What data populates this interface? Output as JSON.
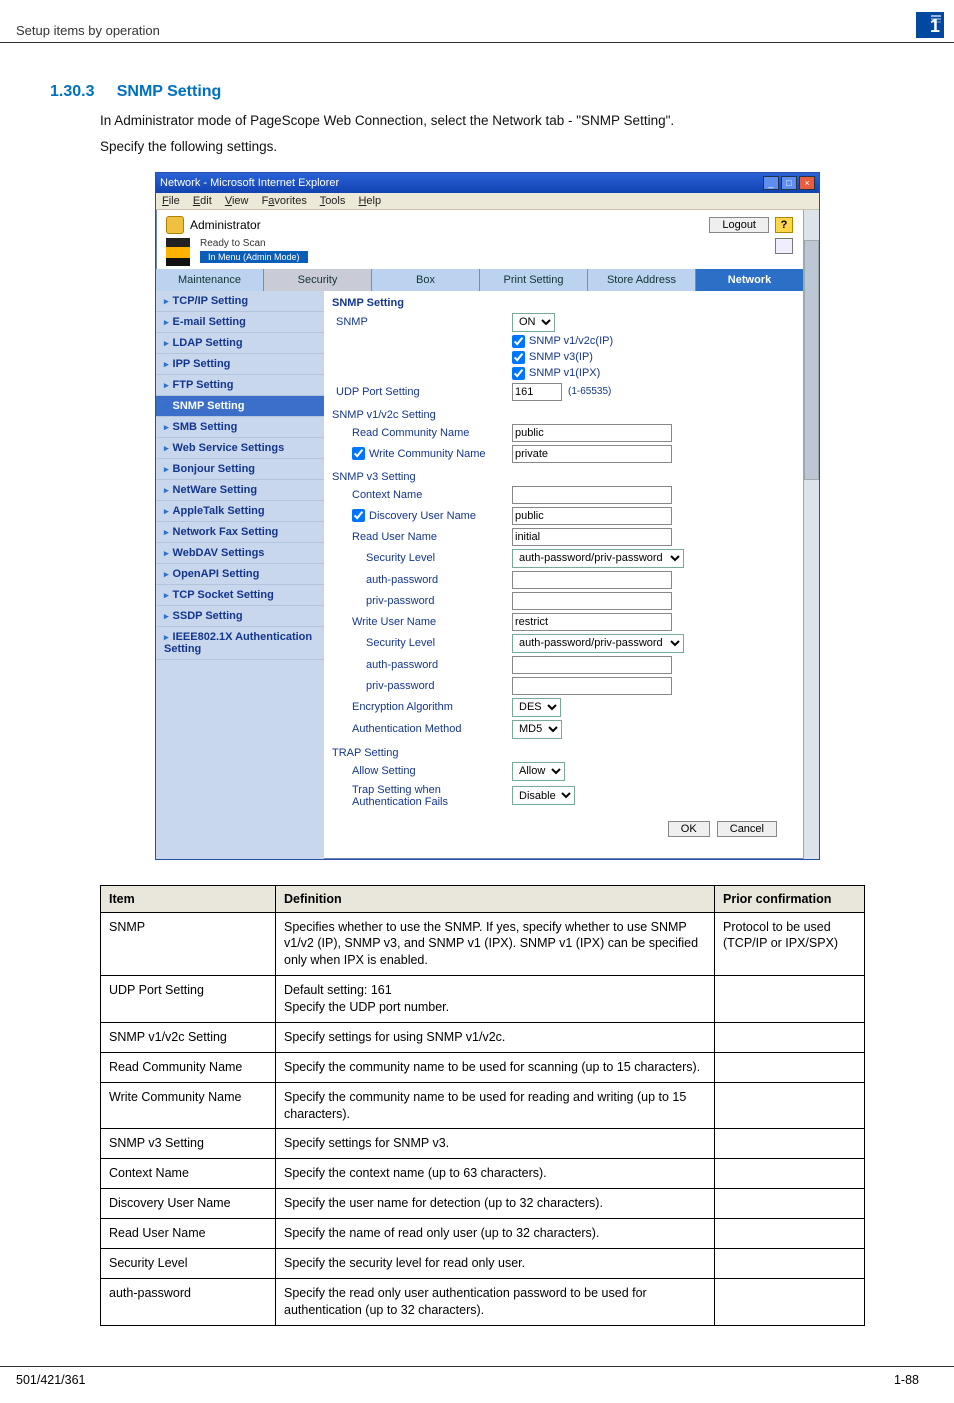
{
  "page": {
    "header_left": "Setup items by operation",
    "badge": "1",
    "section_number": "1.30.3",
    "section_title": "SNMP Setting",
    "para1": "In Administrator mode of PageScope Web Connection, select the Network tab - \"SNMP Setting\".",
    "para2": "Specify the following settings.",
    "footer_left": "501/421/361",
    "footer_right": "1-88"
  },
  "browser": {
    "title": "Network - Microsoft Internet Explorer",
    "menus": [
      "File",
      "Edit",
      "View",
      "Favorites",
      "Tools",
      "Help"
    ],
    "admin_label": "Administrator",
    "logout": "Logout",
    "ready": "Ready to Scan",
    "mode": "In Menu (Admin Mode)",
    "tabs": {
      "maintenance": "Maintenance",
      "security": "Security",
      "box": "Box",
      "print": "Print Setting",
      "store": "Store Address",
      "network": "Network"
    },
    "sidenav": [
      "TCP/IP Setting",
      "E-mail Setting",
      "LDAP Setting",
      "IPP Setting",
      "FTP Setting",
      "SNMP Setting",
      "SMB Setting",
      "Web Service Settings",
      "Bonjour Setting",
      "NetWare Setting",
      "AppleTalk Setting",
      "Network Fax Setting",
      "WebDAV Settings",
      "OpenAPI Setting",
      "TCP Socket Setting",
      "SSDP Setting",
      "IEEE802.1X Authentication Setting"
    ],
    "panel": {
      "title": "SNMP Setting",
      "snmp_label": "SNMP",
      "snmp_on": "ON",
      "chk_v1v2c": "SNMP v1/v2c(IP)",
      "chk_v3": "SNMP v3(IP)",
      "chk_v1ipx": "SNMP v1(IPX)",
      "udp_label": "UDP Port Setting",
      "udp_value": "161",
      "udp_range": "(1-65535)",
      "grp_v1v2c": "SNMP v1/v2c Setting",
      "read_comm": "Read Community Name",
      "read_comm_v": "public",
      "write_comm": "Write Community Name",
      "write_comm_v": "private",
      "grp_v3": "SNMP v3 Setting",
      "context": "Context Name",
      "disc_user": "Discovery User Name",
      "disc_user_v": "public",
      "read_user": "Read User Name",
      "read_user_v": "initial",
      "sec_level1": "Security Level",
      "sec_level1_v": "auth-password/priv-password",
      "auth_pw": "auth-password",
      "priv_pw": "priv-password",
      "write_user": "Write User Name",
      "write_user_v": "restrict",
      "sec_level2": "Security Level",
      "sec_level2_v": "auth-password/priv-password",
      "enc_alg": "Encryption Algorithm",
      "enc_alg_v": "DES",
      "auth_method": "Authentication Method",
      "auth_method_v": "MD5",
      "grp_trap": "TRAP Setting",
      "allow": "Allow Setting",
      "allow_v": "Allow",
      "trap_fail": "Trap Setting when Authentication Fails",
      "trap_fail_v": "Disable",
      "ok": "OK",
      "cancel": "Cancel"
    }
  },
  "definitions": {
    "headers": {
      "item": "Item",
      "def": "Definition",
      "prior": "Prior confirmation"
    },
    "rows": [
      {
        "item": "SNMP",
        "def": "Specifies whether to use the SNMP. If yes, specify whether to use SNMP v1/v2 (IP), SNMP v3, and SNMP v1 (IPX). SNMP v1 (IPX) can be specified only when IPX is enabled.",
        "prior": "Protocol to be used (TCP/IP or IPX/SPX)"
      },
      {
        "item": "UDP Port Setting",
        "def": "Default setting: 161\nSpecify the UDP port number.",
        "prior": ""
      },
      {
        "item": "SNMP v1/v2c Setting",
        "def": "Specify settings for using SNMP v1/v2c.",
        "prior": ""
      },
      {
        "item": "Read Community Name",
        "def": "Specify the community name to be used for scanning (up to 15 characters).",
        "prior": ""
      },
      {
        "item": "Write Community Name",
        "def": "Specify the community name to be used for reading and writing (up to 15 characters).",
        "prior": ""
      },
      {
        "item": "SNMP v3 Setting",
        "def": "Specify settings for SNMP v3.",
        "prior": ""
      },
      {
        "item": "Context Name",
        "def": "Specify the context name (up to 63 characters).",
        "prior": ""
      },
      {
        "item": "Discovery User Name",
        "def": "Specify the user name for detection (up to 32 characters).",
        "prior": ""
      },
      {
        "item": "Read User Name",
        "def": "Specify the name of read only user (up to 32 characters).",
        "prior": ""
      },
      {
        "item": "Security Level",
        "def": "Specify the security level for read only user.",
        "prior": ""
      },
      {
        "item": "auth-password",
        "def": "Specify the read only user authentication password to be used for authentication (up to 32 characters).",
        "prior": ""
      }
    ]
  }
}
